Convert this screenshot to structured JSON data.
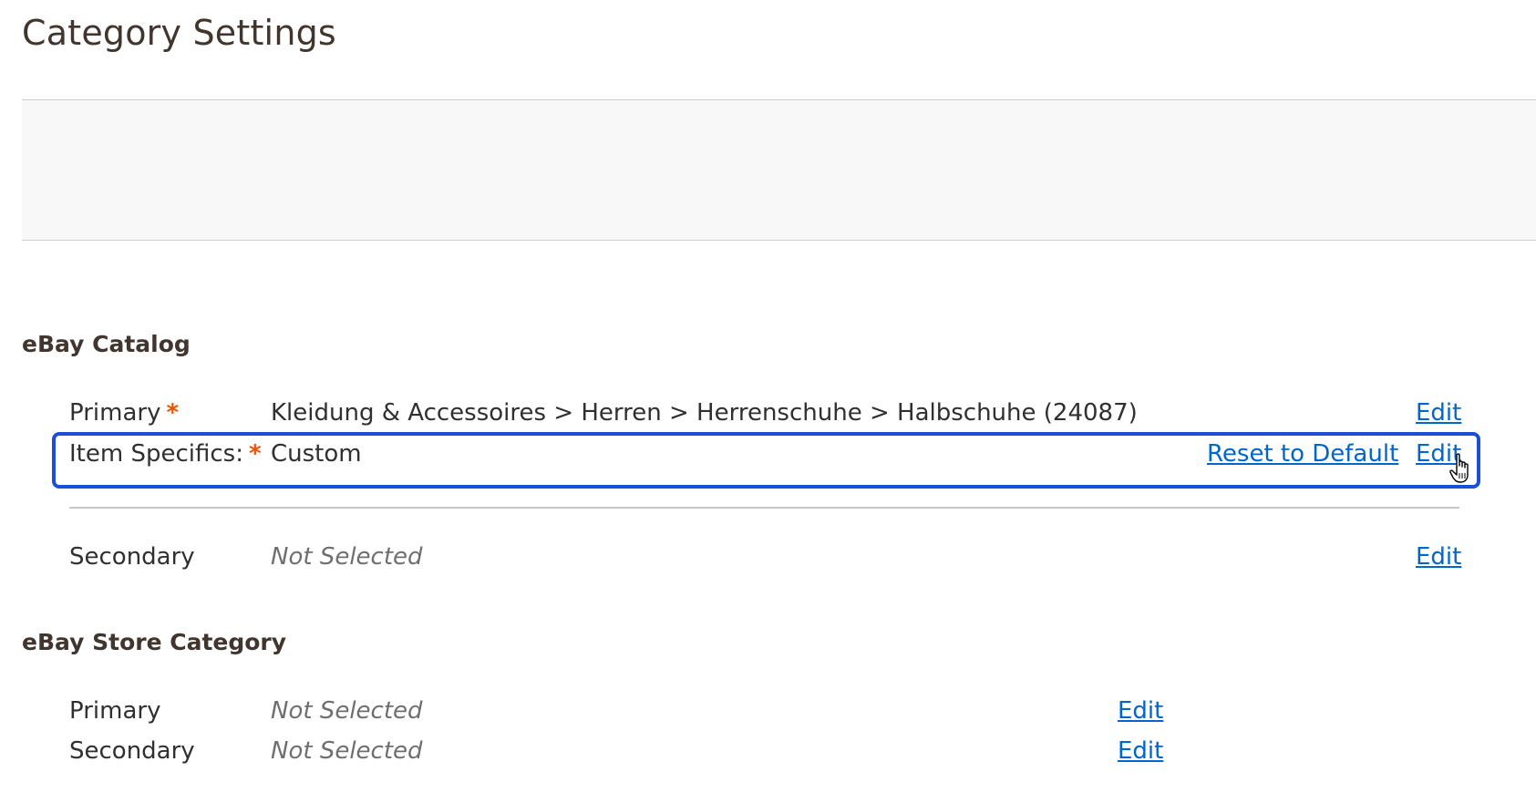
{
  "page_title": "Category Settings",
  "ebay_catalog": {
    "section_title": "eBay Catalog",
    "primary": {
      "label": "Primary",
      "required_mark": "*",
      "value": "Kleidung & Accessoires > Herren > Herrenschuhe > Halbschuhe (24087)",
      "edit_label": "Edit"
    },
    "item_specifics": {
      "label": "Item Specifics:",
      "required_mark": "*",
      "value": "Custom",
      "reset_label": "Reset to Default",
      "edit_label": "Edit"
    },
    "secondary": {
      "label": "Secondary",
      "value": "Not Selected",
      "edit_label": "Edit"
    }
  },
  "ebay_store_category": {
    "section_title": "eBay Store Category",
    "primary": {
      "label": "Primary",
      "value": "Not Selected",
      "edit_label": "Edit"
    },
    "secondary": {
      "label": "Secondary",
      "value": "Not Selected",
      "edit_label": "Edit"
    }
  },
  "colors": {
    "link": "#0066cc",
    "required": "#eb5202",
    "highlight": "#1a4fd6"
  }
}
